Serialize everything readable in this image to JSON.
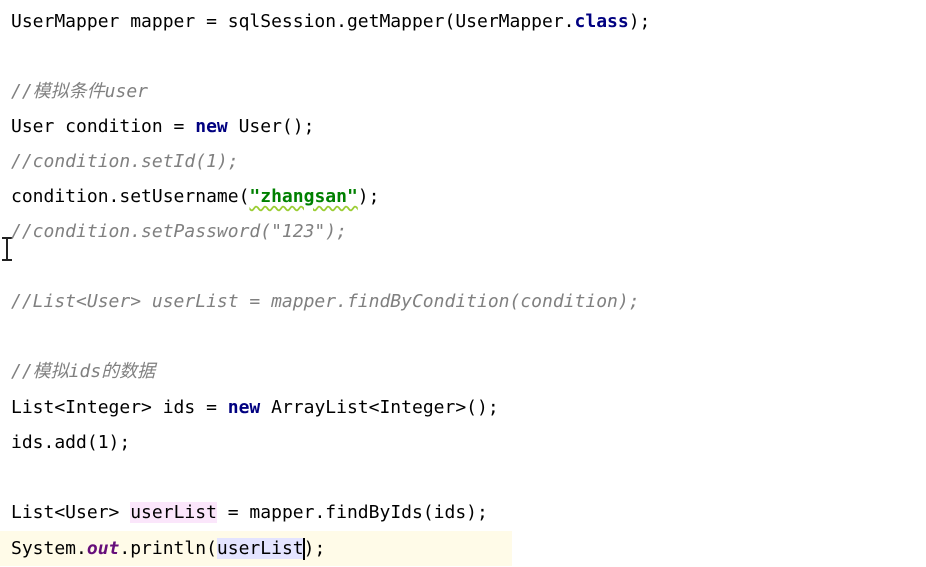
{
  "editor": {
    "lines": [
      "UserMapper mapper = sqlSession.getMapper(UserMapper.",
      "class",
      ");",
      "//模拟条件user",
      "User condition = ",
      "new",
      " User();",
      "//condition.setId(1);",
      "condition.setUsername(",
      "\"zhangsan\"",
      ");",
      "//condition.setPassword(\"123\");",
      "//List<User> userList = mapper.findByCondition(condition);",
      "//模拟ids的数据",
      "List<Integer> ids = ",
      "new",
      " ArrayList<Integer>();",
      "ids.add(1);",
      "List<User> ",
      "userList",
      " = mapper.findByIds(ids);",
      "System.",
      "out",
      ".println(",
      "userList",
      ");"
    ]
  },
  "colors": {
    "keyword": "#000080",
    "comment": "#808080",
    "string": "#008000",
    "static_field": "#660e7a",
    "highlight_usage": "#fbe6fb",
    "highlight_caret_word": "#e4e4ff",
    "caret_row": "#fffbe8"
  }
}
